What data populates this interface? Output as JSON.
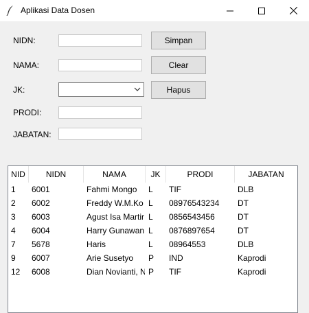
{
  "window": {
    "title": "Aplikasi Data Dosen"
  },
  "form": {
    "nidn_label": "NIDN:",
    "nama_label": "NAMA:",
    "jk_label": "JK:",
    "prodi_label": "PRODI:",
    "jabatan_label": "JABATAN:",
    "nidn_value": "",
    "nama_value": "",
    "jk_value": "",
    "prodi_value": "",
    "jabatan_value": ""
  },
  "buttons": {
    "simpan": "Simpan",
    "clear": "Clear",
    "hapus": "Hapus"
  },
  "table": {
    "columns": [
      "NID",
      "NIDN",
      "NAMA",
      "JK",
      "PRODI",
      "JABATAN"
    ],
    "rows": [
      [
        "1",
        "6001",
        "Fahmi Mongo",
        "L",
        "TIF",
        "DLB"
      ],
      [
        "2",
        "6002",
        "Freddy W.M.Ko",
        "L",
        "08976543234",
        "DT"
      ],
      [
        "3",
        "6003",
        "Agust Isa Martir",
        "L",
        "0856543456",
        "DT"
      ],
      [
        "4",
        "6004",
        "Harry Gunawan",
        "L",
        "0876897654",
        "DT"
      ],
      [
        "7",
        "5678",
        "Haris",
        "L",
        "08964553",
        "DLB"
      ],
      [
        "9",
        "6007",
        "Arie Susetyo",
        "P",
        "IND",
        "Kaprodi"
      ],
      [
        "12",
        "6008",
        "Dian Novianti, N",
        "P",
        "TIF",
        "Kaprodi"
      ]
    ]
  },
  "icons": {
    "app": "feather-icon",
    "minimize": "minimize-icon",
    "maximize": "maximize-icon",
    "close": "close-icon",
    "dropdown": "chevron-down-icon"
  }
}
